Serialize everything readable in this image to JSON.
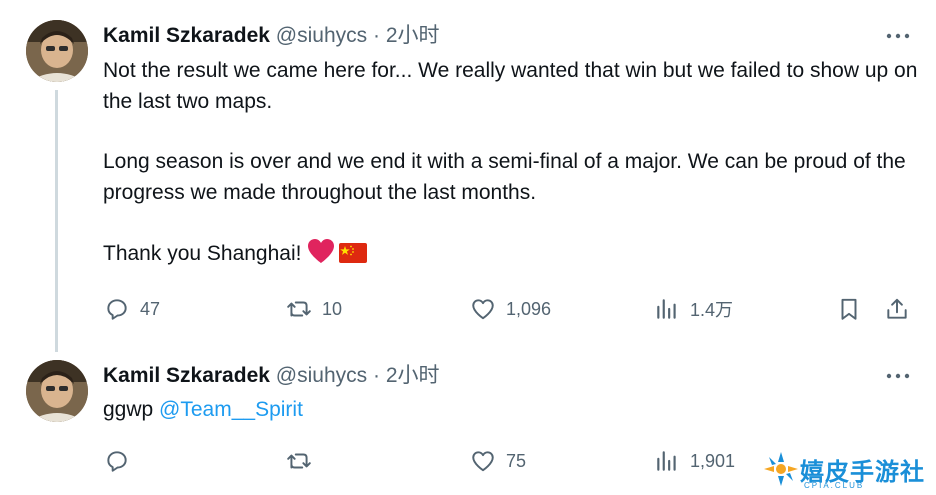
{
  "tweets": [
    {
      "author_name": "Kamil Szkaradek",
      "handle": "@siuhycs",
      "separator": "·",
      "time": "2小时",
      "paragraphs": [
        "Not the result we came here for... We really wanted that win but we failed to show up on the last two maps.",
        "Long season is over and we end it with a semi-final of a major. We can be proud of the progress we made throughout the last months.",
        "Thank you Shanghai!"
      ],
      "emoji": [
        "red-heart",
        "flag-china"
      ],
      "replies": "47",
      "retweets": "10",
      "likes": "1,096",
      "views": "1.4万"
    },
    {
      "author_name": "Kamil Szkaradek",
      "handle": "@siuhycs",
      "separator": "·",
      "time": "2小时",
      "text": "ggwp",
      "mention": "@Team__Spirit",
      "replies": "",
      "retweets": "",
      "likes": "75",
      "views": "1,901"
    }
  ],
  "watermark": {
    "text": "嬉皮手游社",
    "subtext": "CPIA.CLUB"
  },
  "colors": {
    "text": "#0f1419",
    "secondary": "#536471",
    "link": "#1d9bf0",
    "thread_line": "#cfd9de",
    "heart": "#e0245e",
    "flag_red": "#de2910",
    "flag_star": "#ffde00"
  }
}
